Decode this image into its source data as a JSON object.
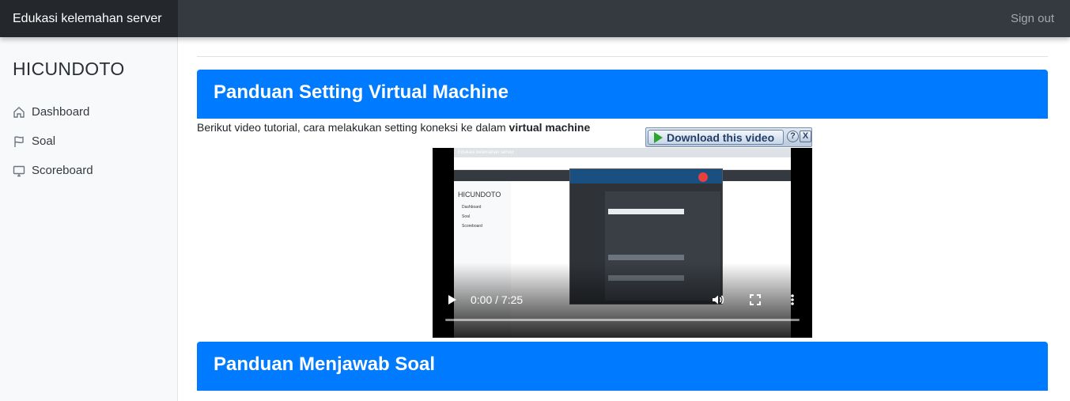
{
  "app": {
    "brand": "Edukasi kelemahan server",
    "sign_out": "Sign out"
  },
  "sidebar": {
    "title": "HICUNDOTO",
    "items": [
      {
        "label": "Dashboard",
        "icon": "home-icon"
      },
      {
        "label": "Soal",
        "icon": "flag-icon"
      },
      {
        "label": "Scoreboard",
        "icon": "monitor-icon"
      }
    ]
  },
  "main": {
    "section1": {
      "title": "Panduan Setting Virtual Machine",
      "description": "Berikut video tutorial, cara melakukan setting koneksi ke dalam ",
      "description_bold": "virtual machine"
    },
    "download": {
      "label": "Download this video",
      "help": "?",
      "close": "X"
    },
    "video": {
      "time": "0:00 / 7:25",
      "progress": 0.0,
      "thumbnail": {
        "brand": "Edukasi kelemahan server",
        "title": "HICUNDOTO",
        "items": [
          "Dashboard",
          "Soal",
          "Scoreboard"
        ]
      }
    },
    "section2": {
      "title": "Panduan Menjawab Soal"
    }
  }
}
